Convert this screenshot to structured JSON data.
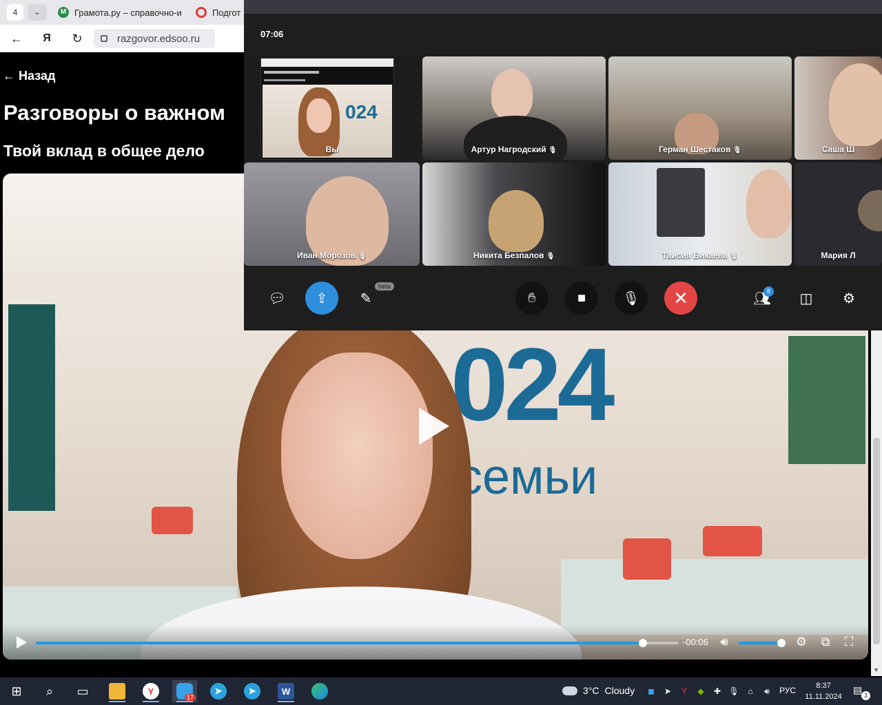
{
  "browser": {
    "tab_count": "4",
    "tabs": [
      {
        "label": "Грамота.ру – справочно-и",
        "favicon": "M"
      },
      {
        "label": "Подгот",
        "favicon": ""
      }
    ],
    "address": "razgovor.edsoo.ru"
  },
  "page": {
    "back_label": "← Назад",
    "title": "Разговоры о важном",
    "subtitle": "Твой вклад в общее дело"
  },
  "video": {
    "banner_number": "024",
    "banner_word": "семьи",
    "progress": 0.945,
    "time_remaining": "-00:06",
    "volume": 1.0
  },
  "call": {
    "timer": "07:06",
    "participants": [
      {
        "name": "Вы",
        "muted": false
      },
      {
        "name": "Артур Нагродский",
        "muted": true
      },
      {
        "name": "Герман Шестаков",
        "muted": true
      },
      {
        "name": "Саша Ш",
        "muted": false
      },
      {
        "name": "Иван Морозов",
        "muted": true
      },
      {
        "name": "Никита Безпалов",
        "muted": true
      },
      {
        "name": "Таисия Бикаева",
        "muted": true
      },
      {
        "name": "Мария Л",
        "muted": false
      }
    ],
    "beta_label": "beta",
    "participants_count": "8"
  },
  "taskbar": {
    "temperature": "3°C",
    "weather": "Cloudy",
    "yandex_messenger_badge": "17",
    "language": "РУС",
    "time": "8:37",
    "date": "11.11.2024",
    "notifications": "3"
  },
  "icons": {
    "play": "play-icon",
    "fullscreen": "fullscreen-icon",
    "settings": "gear-icon",
    "hand": "raise-hand-icon",
    "camera": "camera-icon",
    "mic": "microphone-icon",
    "end_call": "close-icon"
  },
  "colors": {
    "accent_blue": "#2f8fdf",
    "end_call_red": "#e44545",
    "progress_blue": "#1e9be3"
  }
}
